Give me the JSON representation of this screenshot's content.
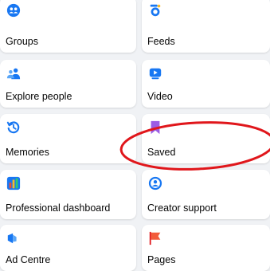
{
  "menu": {
    "items": [
      {
        "label": "Groups",
        "icon": "groups-icon"
      },
      {
        "label": "Feeds",
        "icon": "feeds-icon"
      },
      {
        "label": "Explore people",
        "icon": "people-icon"
      },
      {
        "label": "Video",
        "icon": "video-icon"
      },
      {
        "label": "Memories",
        "icon": "memories-icon"
      },
      {
        "label": "Saved",
        "icon": "bookmark-icon"
      },
      {
        "label": "Professional dashboard",
        "icon": "dashboard-icon"
      },
      {
        "label": "Creator support",
        "icon": "creator-support-icon"
      },
      {
        "label": "Ad Centre",
        "icon": "megaphone-icon"
      },
      {
        "label": "Pages",
        "icon": "flag-icon"
      }
    ]
  },
  "colors": {
    "accent_blue": "#1877f2",
    "saved_purple": "#9b5de5",
    "annotation_red": "#e0161b"
  }
}
